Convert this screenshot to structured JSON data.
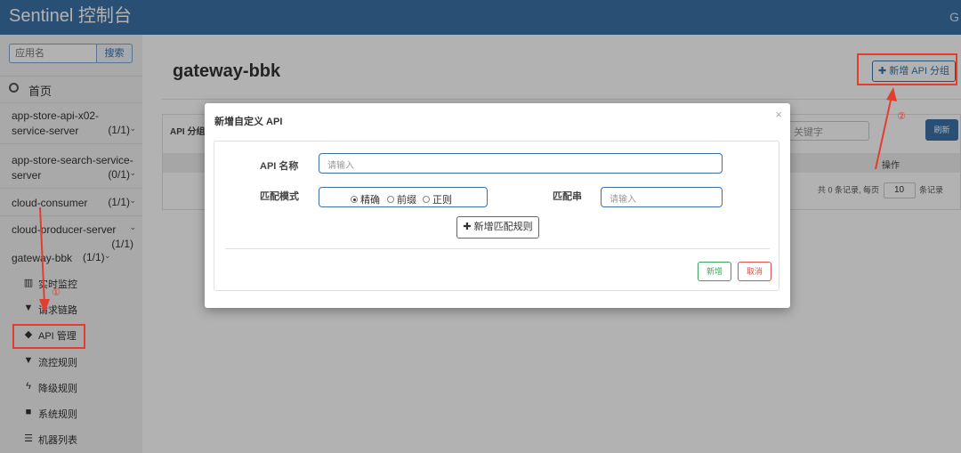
{
  "header": {
    "brand": "Sentinel 控制台",
    "right_glyph": "G"
  },
  "sidebar": {
    "search_placeholder": "应用名",
    "search_button": "搜索",
    "home_label": "首页",
    "apps": [
      {
        "name": "app-store-api-x02-service-server",
        "count": "(1/1)"
      },
      {
        "name": "app-store-search-service-server",
        "count": "(0/1)"
      },
      {
        "name": "cloud-consumer",
        "count": "(1/1)"
      },
      {
        "name": "cloud-producer-server",
        "count": "(1/1)"
      },
      {
        "name": "gateway-bbk",
        "count": "(1/1)"
      }
    ],
    "menu": [
      {
        "icon": "bar-chart-icon",
        "label": "实时监控"
      },
      {
        "icon": "filter-icon",
        "label": "请求链路"
      },
      {
        "icon": "tags-icon",
        "label": "API 管理"
      },
      {
        "icon": "filter-icon",
        "label": "流控规则"
      },
      {
        "icon": "flash-icon",
        "label": "降级规则"
      },
      {
        "icon": "lock-icon",
        "label": "系统规则"
      },
      {
        "icon": "list-icon",
        "label": "机器列表"
      }
    ]
  },
  "annotations": {
    "circle_1": "①",
    "circle_2": "②"
  },
  "main": {
    "page_title": "gateway-bbk",
    "add_group_button": "新增 API 分组",
    "panel": {
      "header": "API 分组",
      "keyword_placeholder": "关键字",
      "refresh": "刷新",
      "col_ops": "操作",
      "pager_prefix": "共 0 条记录, 每页",
      "page_size": "10",
      "pager_suffix": "条记录"
    }
  },
  "modal": {
    "title": "新增自定义 API",
    "close": "×",
    "api_name_label": "API 名称",
    "api_name_placeholder": "请输入",
    "match_mode_label": "匹配模式",
    "match_modes": [
      {
        "label": "精确",
        "selected": true
      },
      {
        "label": "前缀",
        "selected": false
      },
      {
        "label": "正则",
        "selected": false
      }
    ],
    "match_str_label": "匹配串",
    "match_str_placeholder": "请输入",
    "add_rule_button": "新增匹配规则",
    "save_button": "新增",
    "cancel_button": "取消"
  },
  "colors": {
    "brand": "#3c72a8",
    "annotation": "#e43d30",
    "save": "#3aa55a",
    "cancel": "#d9534f"
  }
}
